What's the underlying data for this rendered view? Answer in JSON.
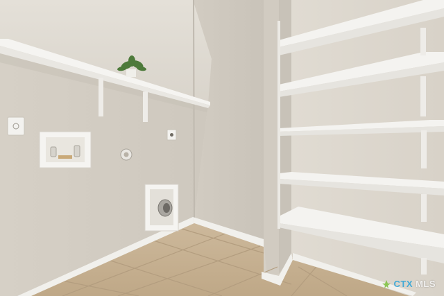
{
  "scene": {
    "description_name": "laundry-room-photo",
    "colors": {
      "wall_left": "#d8d2c8",
      "wall_mid": "#cfc9bf",
      "wall_right": "#dcd6cc",
      "shelf": "#f4f3f0",
      "floor_tile": "#c9b497",
      "grout": "#b8a284",
      "baseboard": "#f2f1ee",
      "plant": "#4d7a3a"
    }
  },
  "watermark": {
    "brand_ctx": "CTX",
    "brand_mls": "MLS",
    "accent": "#29a3d9"
  }
}
